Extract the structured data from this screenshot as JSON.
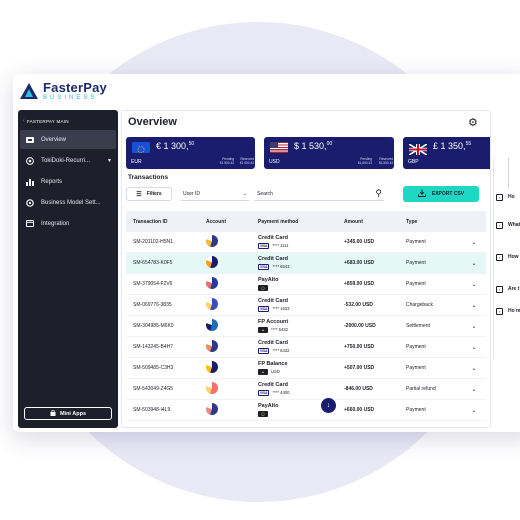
{
  "brand": {
    "name": "FasterPay",
    "sub": "BUSINESS"
  },
  "sidebar": {
    "back_label": "FASTERPAY MAIN",
    "items": [
      {
        "label": "Overview",
        "icon": "overview-icon"
      },
      {
        "label": "TokiDoki-Recurri...",
        "icon": "globe-icon"
      },
      {
        "label": "Reports",
        "icon": "bar-chart-icon"
      },
      {
        "label": "Business Model Sett...",
        "icon": "settings-icon"
      },
      {
        "label": "Integration",
        "icon": "integration-icon"
      }
    ],
    "mini_apps": "Mini Apps"
  },
  "main": {
    "title": "Overview",
    "balances": [
      {
        "symbol": "€",
        "whole": "1 300,",
        "cents": "50",
        "currency": "EUR",
        "pending_label": "Pending",
        "pending": "€1 500.43",
        "reserved_label": "Reserved",
        "reserved": "€1 500.43",
        "accent": "#1a4fd8"
      },
      {
        "symbol": "$",
        "whole": "1 530,",
        "cents": "00",
        "currency": "USD",
        "pending_label": "Pending",
        "pending": "$1,600.43",
        "reserved_label": "Reserved",
        "reserved": "$1,500.43",
        "accent": "#b22234"
      },
      {
        "symbol": "£",
        "whole": "1 350,",
        "cents": "55",
        "currency": "GBP",
        "accent": "#012169"
      }
    ],
    "transactions_title": "Transactions",
    "toolbar": {
      "filters_label": "Filters",
      "user_id_label": "User ID",
      "search_placeholder": "Search",
      "export_label": "EXPORT CSV"
    },
    "columns": [
      "Transaction ID",
      "Account",
      "Payment method",
      "Amount",
      "Type"
    ],
    "rows": [
      {
        "id": "SM-201102-H5N1",
        "method": "Credit Card",
        "sub_badge": "VISA",
        "sub_text": "**** 1111",
        "amount": "+345.00 USD",
        "type": "Payment"
      },
      {
        "id": "SM-654783-K0F5",
        "method": "Credit Card",
        "sub_badge": "VISA",
        "sub_text": "**** 6543",
        "amount": "+683.00 USD",
        "type": "Payment"
      },
      {
        "id": "SM-379054-F2V6",
        "method": "PayAlto",
        "sub_badge": "PA",
        "sub_text": "",
        "amount": "+859.00 USD",
        "type": "Payment"
      },
      {
        "id": "SM-069776-3835",
        "method": "Credit Card",
        "sub_badge": "VISA",
        "sub_text": "**** 1633",
        "amount": "-532.00 USD",
        "type": "Chargeback"
      },
      {
        "id": "SM-304985-M6K0",
        "method": "FP Account",
        "sub_badge": "FP",
        "sub_text": "**** 5432",
        "amount": "-2000.00 USD",
        "type": "Settlement"
      },
      {
        "id": "SM-143245-B4H7",
        "method": "Credit Card",
        "sub_badge": "VISA",
        "sub_text": "**** 6432",
        "amount": "+750.00 USD",
        "type": "Payment"
      },
      {
        "id": "SM-509485-C3H3",
        "method": "FP Balance",
        "sub_badge": "FP",
        "sub_text": "USD",
        "amount": "+507.00 USD",
        "type": "Payment"
      },
      {
        "id": "SM-543049-Z4G5",
        "method": "Credit Card",
        "sub_badge": "VISA",
        "sub_text": "**** 4400",
        "amount": "-846.00 USD",
        "type": "Partial refund"
      },
      {
        "id": "SM-503948-I4L9",
        "method": "PayAlto",
        "sub_badge": "PA",
        "sub_text": "",
        "amount": "+660.00 USD",
        "type": "Payment"
      }
    ]
  },
  "faq": [
    {
      "text": "Ho"
    },
    {
      "text": "What"
    },
    {
      "text": "How i calcul"
    },
    {
      "text": "Are t"
    },
    {
      "text": "Ho m"
    }
  ]
}
